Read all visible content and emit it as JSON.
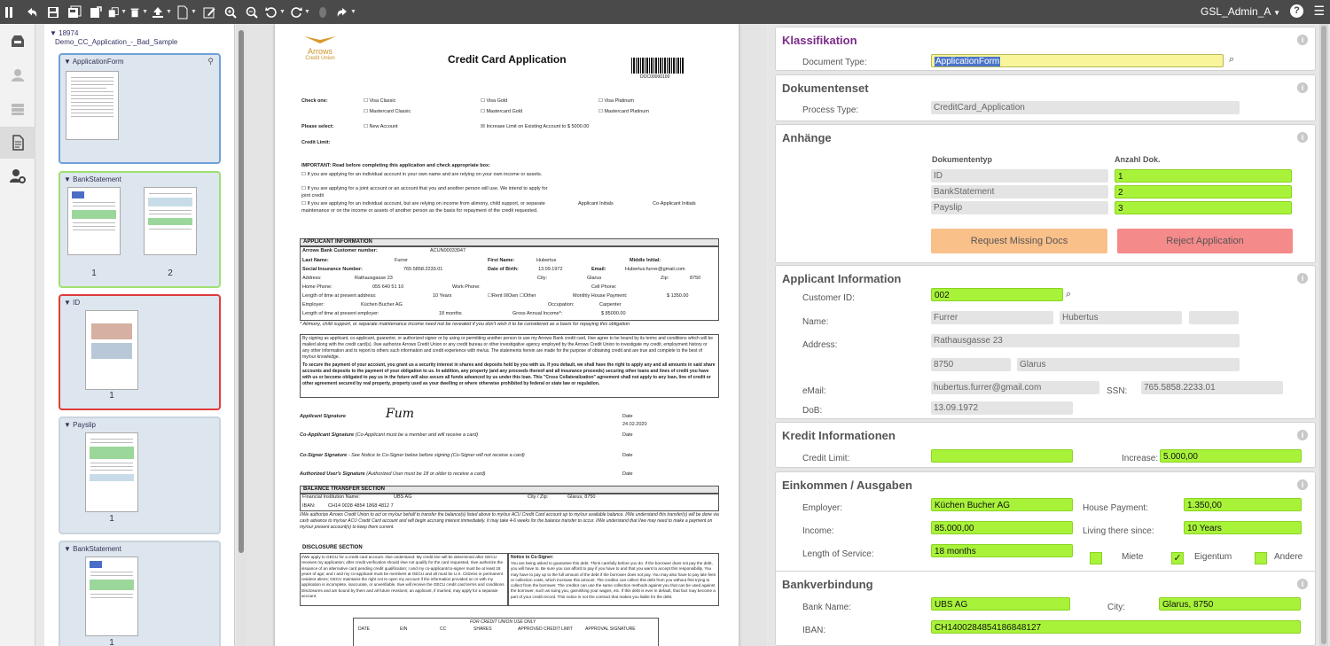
{
  "toolbar": {
    "user": "GSL_Admin_A",
    "help": "?"
  },
  "tree": {
    "root_id": "18974",
    "root_name": "Demo_CC_Application_-_Bad_Sample",
    "groups": [
      {
        "label": "ApplicationForm",
        "pages": []
      },
      {
        "label": "BankStatement",
        "pages": [
          "1",
          "2"
        ]
      },
      {
        "label": "ID",
        "pages": [
          "1"
        ]
      },
      {
        "label": "Payslip",
        "pages": [
          "1"
        ]
      },
      {
        "label": "BankStatement",
        "pages": [
          "1"
        ]
      }
    ]
  },
  "doc": {
    "title": "Credit Card Application",
    "logo": "Arrows",
    "logo_sub": "Credit Union",
    "barcode": "DOC00000100",
    "check_one": "Check one:",
    "visa_classic": "Visa Classic",
    "visa_gold": "Visa Gold",
    "visa_platinum": "Visa Platinum",
    "mc_classic": "Mastercard Classic",
    "mc_gold": "Mastercard Gold",
    "mc_platinum": "Mastercard Platinum",
    "please_select": "Please select:",
    "new_account": "New Account",
    "increase_limit": "Increase Limit on Existing Account to $ 5000.00",
    "credit_limit": "Credit Limit:",
    "important": "IMPORTANT: Read before completing this application and check appropriate box:",
    "opt1": "If you are applying for an individual account in your own name and are relying on your own income or assets.",
    "opt2": "If you are applying for a joint account or an account that you and another person will use. We intend to apply for joint credit",
    "opt3": "If you are applying for an individual account, but are relying on income from alimony, child support, or separate maintenance or on the income or assets of another person as the basis for repayment of the credit requested.",
    "applicant_initials": "Applicant Initials",
    "coapplicant_initials": "Co-Applicant Initials",
    "applicant_info": "APPLICANT INFORMATION",
    "bank_cust": "Arrows Bank Customer number:",
    "cust_no": "ACUN00033947",
    "last_name": "Last Name:",
    "last_name_val": "Furrer",
    "first_name": "First Name:",
    "first_name_val": "Hubertus",
    "middle_initial": "Middle Initial:",
    "ssn_label": "Social Insurance Number:",
    "ssn_val": "765.5858.2233.01",
    "dob_label": "Date of Birth:",
    "dob_val": "13.09.1972",
    "email_label": "Email:",
    "email_val": "Hubertus.furrer@gmail.com",
    "address_label": "Address:",
    "address_val": "Rathausgasse 23",
    "city_label": "City:",
    "city_val": "Glarus",
    "zip_label": "Zip:",
    "zip_val": "8750",
    "home_phone": "Home Phone:",
    "home_phone_val": "055 640 51 10",
    "work_phone": "Work Phone:",
    "cell_phone": "Cell Phone:",
    "time_address": "Length of time at present address:",
    "time_address_val": "10 Years",
    "rent_own": "☐Rent ☒Own ☐Other",
    "house_payment": "Monthly House Payment:",
    "house_payment_val": "$ 1350.00",
    "employer": "Employer:",
    "employer_val": "Küchen Bucher AG",
    "occupation": "Occupation:",
    "occupation_val": "Carpenter",
    "time_employer": "Length of time at present employer:",
    "time_employer_val": "18 months",
    "gross_income": "Gross Annual Income*:",
    "gross_income_val": "$ 85000.00",
    "alimony_note": "* Alimony, child support, or separate maintenance income need not be revealed if you don't wish it to be considered as a basis for repaying this obligation",
    "sign_text": "By signing as applicant, co-applicant, guarantor, or authorized signer or by using or permitting another person to use my Arrows Bank credit card, I/we agree to be bound by its terms and conditions which will be mailed along with the credit card(s). I/we authorize Arrows Credit Union or any credit bureau or other investigative agency employed by the Arrows Credit Union to investigate my credit, employment history or any other information and to report to others such information and credit experience with me/us. The statements herein are made for the purpose of obtaining credit and are true and complete to the best of my/our knowledge.",
    "secure_text": "To secure the payment of your account, you grant us a security interest in shares and deposits held by you with us. If you default, we shall have the right to apply any and all amounts in said share accounts and deposits to the payment of your obligation to us. In addition, any property (and any proceeds thereof and all insurance proceeds) securing other loans and lines of credit you have with us or become obligated to pay us in the future will also secure all funds advanced by us under this loan. This \"Cross Collateralization\" agreement shall not apply to any loan, line of credit or other agreement secured by real property, property used as your dwelling or where otherwise prohibited by federal or state law or regulation.",
    "applicant_sig": "Applicant Signature",
    "date": "Date",
    "sig_date": "24.02.2020",
    "coapp_sig": "Co-Applicant Signature",
    "coapp_sig_note": "(Co-Applicant must be a member and will receive a card)",
    "cosigner_sig": "Co-Signer Signature",
    "cosigner_note": "- See Notice to Co-Signer below before signing (Co-Signer will not receive a card)",
    "auth_sig": "Authorized User's Signature",
    "auth_note": "(Authorized User must be 18 or older to receive a card)",
    "balance_transfer": "BALANCE TRANSFER SECTION",
    "fin_inst": "Financial Institution Name:",
    "fin_inst_val": "UBS AG",
    "city_zip": "City / Zip:",
    "city_zip_val": "Glarus, 8750",
    "iban_label": "IBAN:",
    "iban_val": "CH14 0028 4854 1868 4812 7",
    "transfer_text": "I/We authorize Arrows Credit Union to act on my/our behalf to transfer the balance(s) listed above to my/our ACU Credit Card account up to my/our available balance. I/We understand this transfer(s) will be done via cash advance to my/our ACU Credit Card account and will begin accruing interest immediately. It may take 4-6 weeks for the balance transfer to occur. I/We understand that I/we may need to make a payment on my/our present account(s) to keep them current.",
    "disclosure": "DISCLOSURE SECTION",
    "disclosure_text": "I/We apply to GECU for a credit card account. I/we understand: My credit line will be determined after GECU receives my application; after credit verification should I/we not qualify for the card requested, I/we authorize the issuance of an alternative card pending credit qualification; I and my co-applicant/co-signer must be at least 18 years of age; and I and my co-applicant must be members at GECU and all must be U.S. Citizens or permanent resident aliens; GECU maintains the right not to open my account if the information provided on or with my application is incomplete, inaccurate, or unverifiable. I/we will receive the GECU credit card terms and conditions Disclosures and am bound by them and all future revisions; an applicant, if married, may apply for a separate account.",
    "cosigner_notice": "Notice to Co-Signer:",
    "cosigner_text": "You are being asked to guarantee this debt. Think carefully before you do. If the borrower does not pay the debt, you will have to. Be sure you can afford to pay if you have to and that you want to accept this responsibility. You may have to pay up to the full amount of the debt if the borrower does not pay. You may also have to pay late fees or collection costs, which increase this amount. The creditor can collect this debt from you without first trying to collect from the borrower. The creditor can use the same collection methods against you that can be used against the borrower, such as suing you, garnishing your wages, etc. If this debt is ever in default, that fact may become a part of your credit record. This notice is not the contract that makes you liable for the debt.",
    "cu_use": "FOR CREDIT UNION USE ONLY",
    "cu_cols": [
      "DATE",
      "EIN",
      "CC",
      "SHARES",
      "APPROVED CREDIT LIMIT",
      "APPROVAL SIGNATURE"
    ]
  },
  "klass": {
    "title": "Klassifikation",
    "doc_type_label": "Document Type:",
    "doc_type": "ApplicationForm"
  },
  "docset": {
    "title": "Dokumentenset",
    "process_label": "Process Type:",
    "process": "CreditCard_Application"
  },
  "anhaenge": {
    "title": "Anhänge",
    "col1": "Dokumententyp",
    "col2": "Anzahl Dok.",
    "rows": [
      {
        "type": "ID",
        "count": "1"
      },
      {
        "type": "BankStatement",
        "count": "2"
      },
      {
        "type": "Payslip",
        "count": "3"
      }
    ],
    "request_btn": "Request Missing Docs",
    "reject_btn": "Reject Application"
  },
  "applicant": {
    "title": "Applicant Information",
    "customer_id_label": "Customer ID:",
    "customer_id": "002",
    "name_label": "Name:",
    "last": "Furrer",
    "first": "Hubertus",
    "middle": "",
    "address_label": "Address:",
    "street": "Rathausgasse 23",
    "zip": "8750",
    "city": "Glarus",
    "email_label": "eMail:",
    "email": "hubertus.furrer@gmail.com",
    "ssn_label": "SSN:",
    "ssn": "765.5858.2233.01",
    "dob_label": "DoB:",
    "dob": "13.09.1972"
  },
  "kredit": {
    "title": "Kredit Informationen",
    "limit_label": "Credit Limit:",
    "limit": "",
    "increase_label": "Increase:",
    "increase": "5.000,00"
  },
  "einkommen": {
    "title": "Einkommen / Ausgaben",
    "employer_label": "Employer:",
    "employer": "Küchen Bucher AG",
    "house_label": "House Payment:",
    "house": "1.350,00",
    "income_label": "Income:",
    "income": "85.000,00",
    "living_label": "Living there since:",
    "living": "10 Years",
    "service_label": "Length of Service:",
    "service": "18 months",
    "miete": "Miete",
    "eigentum": "Eigentum",
    "andere": "Andere",
    "check": "✓"
  },
  "bank": {
    "title": "Bankverbindung",
    "name_label": "Bank Name:",
    "name": "UBS AG",
    "city_label": "City:",
    "city": "Glarus, 8750",
    "iban_label": "IBAN:",
    "iban": "CH1400284854186848127"
  },
  "colors": {
    "toolbar": "#4a4a4a",
    "green": "#a8f33a",
    "orange": "#f9c08a",
    "red": "#f58a8a",
    "purple": "#7a2a8a"
  }
}
